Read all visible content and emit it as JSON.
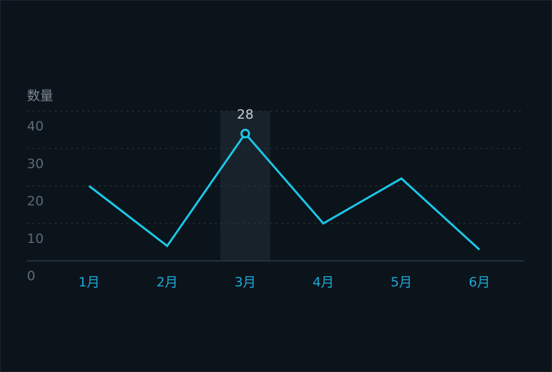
{
  "chart_data": {
    "type": "line",
    "title": "",
    "ylabel": "数量",
    "xlabel": "",
    "categories": [
      "1月",
      "2月",
      "3月",
      "4月",
      "5月",
      "6月"
    ],
    "series": [
      {
        "values": [
          20,
          4,
          34,
          10,
          22,
          3
        ]
      }
    ],
    "yticks": [
      0,
      10,
      20,
      30,
      40
    ],
    "ylim": [
      0,
      40
    ],
    "grid": true,
    "highlight": {
      "index": 2,
      "label": "28"
    },
    "colors": {
      "line": "#1ac8e8",
      "background": "#0b141b",
      "highlight_band": "#18222b",
      "xtick": "#1fa8d8",
      "grid": "#2a3640"
    }
  }
}
